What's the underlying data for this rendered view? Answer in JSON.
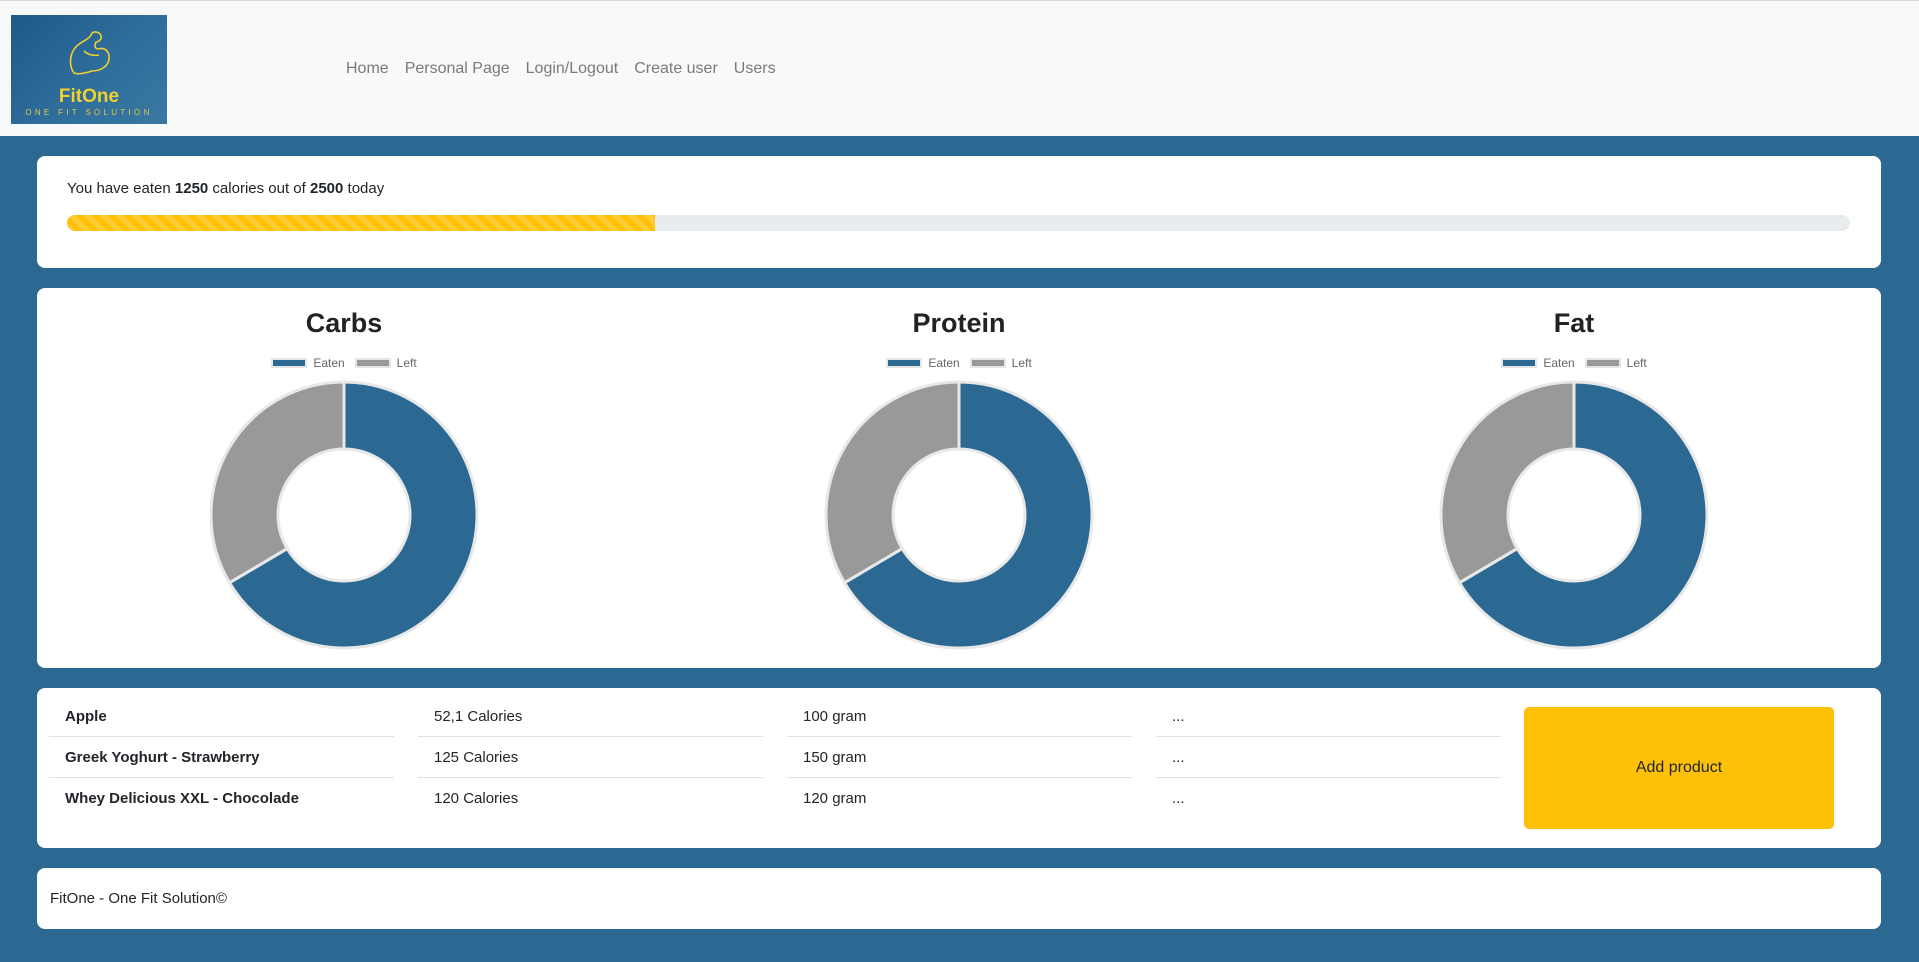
{
  "brand": {
    "name": "FitOne",
    "tagline": "ONE FIT SOLUTION"
  },
  "nav": [
    "Home",
    "Personal Page",
    "Login/Logout",
    "Create user",
    "Users"
  ],
  "calories": {
    "prefix": "You have eaten ",
    "eaten": "1250",
    "middle": " calories out of ",
    "goal": "2500",
    "suffix": " today",
    "progress_fraction": 0.33
  },
  "colors": {
    "eaten": "#2b6892",
    "left": "#999999",
    "accent": "#ffc107",
    "background": "#2b6892"
  },
  "chart_data": [
    {
      "type": "pie",
      "title": "Carbs",
      "labels": [
        "Eaten",
        "Left"
      ],
      "values": [
        66.5,
        33.5
      ]
    },
    {
      "type": "pie",
      "title": "Protein",
      "labels": [
        "Eaten",
        "Left"
      ],
      "values": [
        66.5,
        33.5
      ]
    },
    {
      "type": "pie",
      "title": "Fat",
      "labels": [
        "Eaten",
        "Left"
      ],
      "values": [
        66.5,
        33.5
      ]
    }
  ],
  "products": [
    {
      "name": "Apple",
      "calories": "52,1 Calories",
      "amount": "100 gram",
      "more": "..."
    },
    {
      "name": "Greek Yoghurt - Strawberry",
      "calories": "125 Calories",
      "amount": "150 gram",
      "more": "..."
    },
    {
      "name": "Whey Delicious XXL - Chocolade",
      "calories": "120 Calories",
      "amount": "120 gram",
      "more": "..."
    }
  ],
  "add_product_label": "Add product",
  "footer": "FitOne - One Fit Solution©"
}
